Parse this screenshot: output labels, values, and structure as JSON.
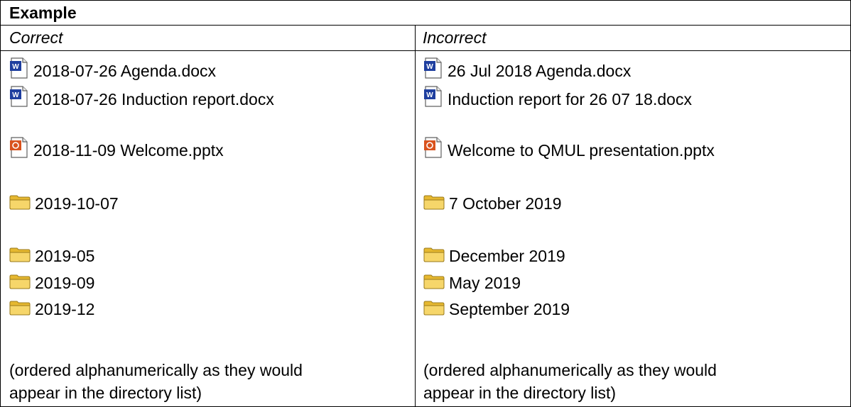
{
  "header": {
    "title": "Example"
  },
  "columns": {
    "correct": {
      "label": "Correct",
      "entries": [
        {
          "icon": "word-doc-icon",
          "text": "2018-07-26 Agenda.docx"
        },
        {
          "icon": "word-doc-icon",
          "text": "2018-07-26 Induction report.docx"
        },
        {
          "icon": "powerpoint-icon",
          "text": "2018-11-09 Welcome.pptx"
        },
        {
          "icon": "folder-icon",
          "text": "2019-10-07"
        },
        {
          "icon": "folder-icon",
          "text": "2019-05"
        },
        {
          "icon": "folder-icon",
          "text": "2019-09"
        },
        {
          "icon": "folder-icon",
          "text": "2019-12"
        }
      ],
      "note_line1": "(ordered alphanumerically as they would",
      "note_line2": "appear in the directory list)"
    },
    "incorrect": {
      "label": "Incorrect",
      "entries": [
        {
          "icon": "word-doc-icon",
          "text": "26 Jul 2018 Agenda.docx"
        },
        {
          "icon": "word-doc-icon",
          "text": "Induction report for 26 07 18.docx"
        },
        {
          "icon": "powerpoint-icon",
          "text": "Welcome to QMUL presentation.pptx"
        },
        {
          "icon": "folder-icon",
          "text": "7 October 2019"
        },
        {
          "icon": "folder-icon",
          "text": "December 2019"
        },
        {
          "icon": "folder-icon",
          "text": "May 2019"
        },
        {
          "icon": "folder-icon",
          "text": "September 2019"
        }
      ],
      "note_line1": "(ordered alphanumerically as they would",
      "note_line2": "appear in the directory list)"
    }
  },
  "colors": {
    "word_blue": "#1f3f9f",
    "powerpoint_orange": "#d9531e",
    "folder_yellow": "#f2c94c",
    "border": "#000000"
  }
}
